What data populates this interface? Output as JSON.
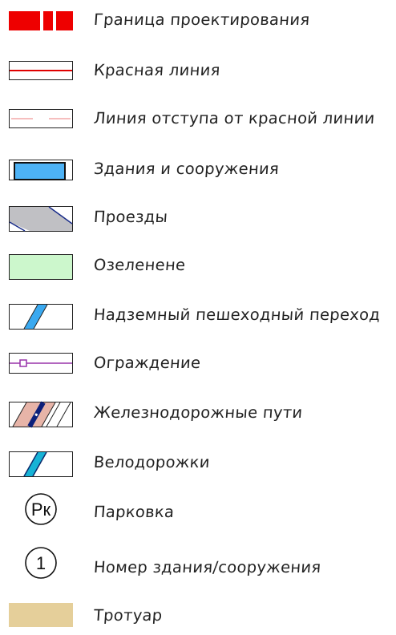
{
  "legend": {
    "items": [
      {
        "label": "Граница проектирования",
        "symbol": "design-boundary"
      },
      {
        "label": "Красная линия",
        "symbol": "red-line"
      },
      {
        "label": "Линия отступа от красной линии",
        "symbol": "setback-line"
      },
      {
        "label": "Здания и сооружения",
        "symbol": "buildings"
      },
      {
        "label": "Проезды",
        "symbol": "driveways"
      },
      {
        "label": "Озеленене",
        "symbol": "greenery"
      },
      {
        "label": "Надземный пешеходный переход",
        "symbol": "footbridge"
      },
      {
        "label": "Ограждение",
        "symbol": "fence"
      },
      {
        "label": "Железнодорожные пути",
        "symbol": "railway"
      },
      {
        "label": "Велодорожки",
        "symbol": "bike-path"
      },
      {
        "label": "Парковка",
        "symbol": "parking",
        "badge": "Рк"
      },
      {
        "label": "Номер здания/сооружения",
        "symbol": "building-number",
        "badge": "1"
      },
      {
        "label": "Тротуар",
        "symbol": "sidewalk"
      }
    ]
  },
  "colors": {
    "boundary_red": "#ee0000",
    "red_line": "#e00000",
    "setback_pink": "#f3a9a9",
    "building_blue": "#4db2f5",
    "driveway_gray": "#c0c0c4",
    "driveway_edge": "#1a2d8a",
    "greenery": "#ccf7cc",
    "footbridge_blue": "#3aa9f0",
    "fence_purple": "#9933aa",
    "rail_pink": "#e7b4a8",
    "rail_navy": "#0c1f7a",
    "bike_cyan": "#17b3d6",
    "sidewalk_tan": "#e5cf9a"
  }
}
